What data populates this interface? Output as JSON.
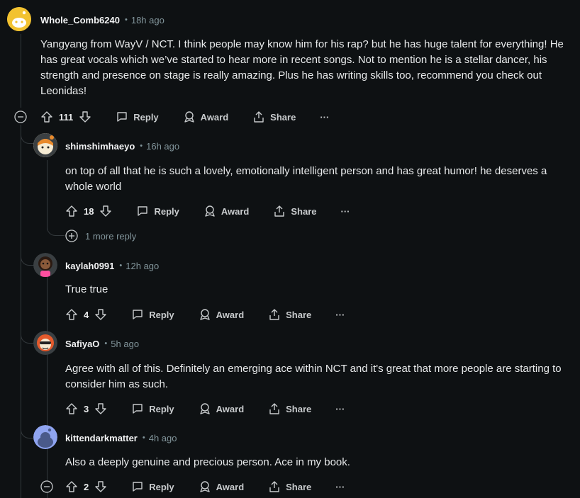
{
  "comments": [
    {
      "username": "Whole_Comb6240",
      "time": "18h ago",
      "body": "Yangyang from WayV / NCT. I think people may know him for his rap? but he has huge talent for everything! He has great vocals which we’ve started to hear more in recent songs. Not to mention he is a stellar dancer, his strength and presence on stage is really amazing. Plus he has writing skills too, recommend you check out Leonidas!",
      "votes": "111",
      "avatar_color": "#f2c230"
    },
    {
      "username": "shimshimhaeyo",
      "time": "16h ago",
      "body": "on top of all that he is such a lovely, emotionally intelligent person and has great humor! he deserves a whole world",
      "votes": "18",
      "more_replies": "1 more reply",
      "avatar_color": "#e7d8b8"
    },
    {
      "username": "kaylah0991",
      "time": "12h ago",
      "body": "True true",
      "votes": "4",
      "avatar_color": "#2a1a12"
    },
    {
      "username": "SafiyaO",
      "time": "5h ago",
      "body": "Agree with all of this. Definitely an emerging ace within NCT and it's great that more people are starting to consider him as such.",
      "votes": "3",
      "avatar_color": "#e45a2c"
    },
    {
      "username": "kittendarkmatter",
      "time": "4h ago",
      "body": "Also a deeply genuine and precious person. Ace in my book.",
      "votes": "2",
      "avatar_color": "#8fa4f0"
    }
  ],
  "actions": {
    "reply": "Reply",
    "award": "Award",
    "share": "Share",
    "more": "···"
  },
  "meta_sep": "•",
  "icons": [
    "upvote-icon",
    "downvote-icon",
    "reply-icon",
    "award-icon",
    "share-icon",
    "overflow-icon",
    "collapse-icon",
    "expand-icon"
  ]
}
